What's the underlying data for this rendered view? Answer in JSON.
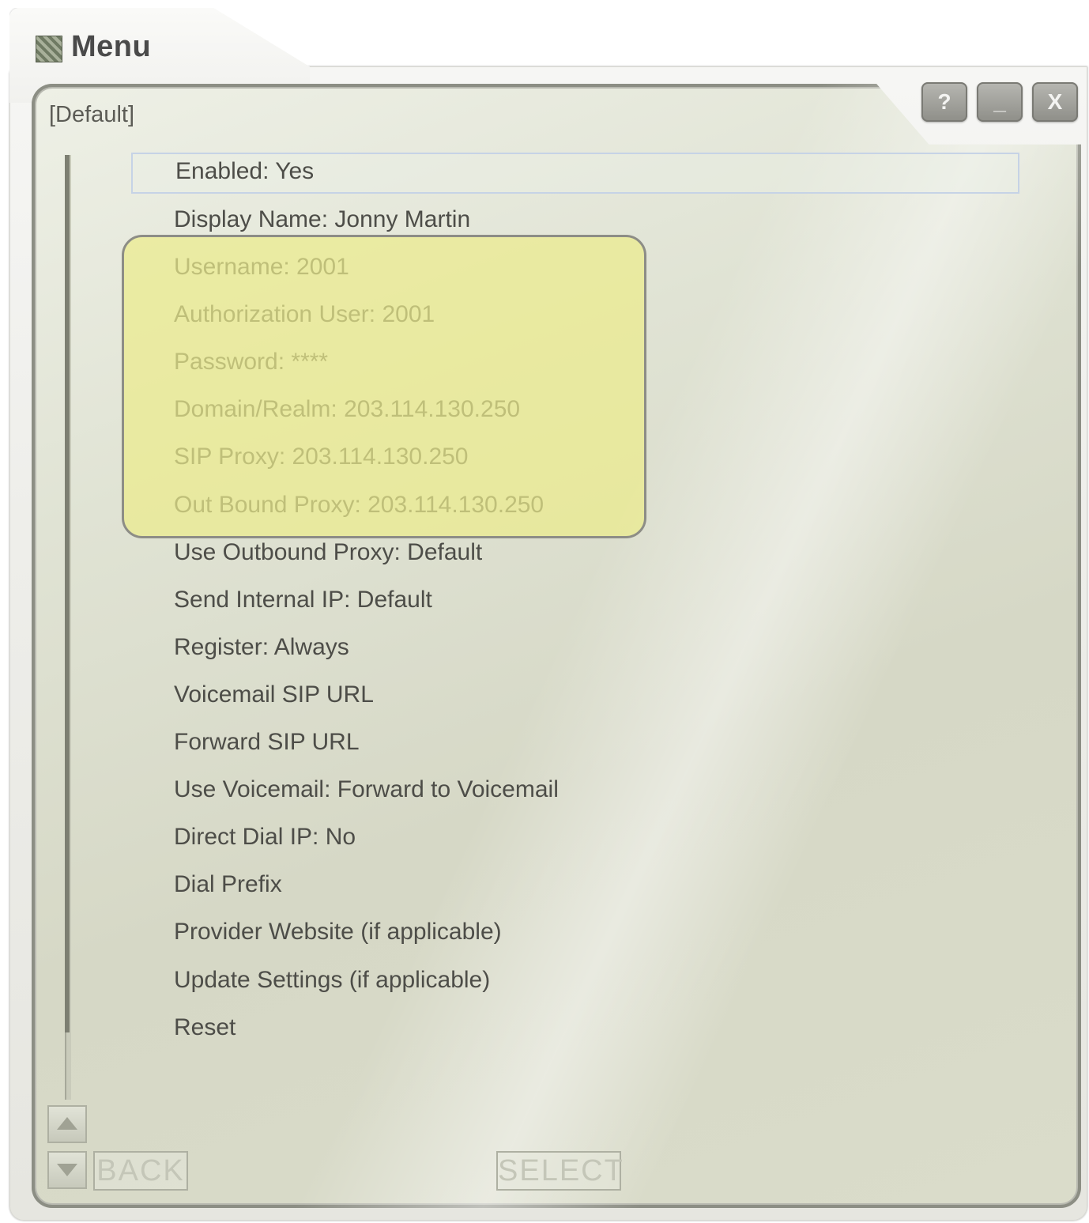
{
  "window": {
    "title": "Menu",
    "icon": "app-icon",
    "controls": {
      "help_label": "?",
      "minimize_label": "_",
      "close_label": "X"
    }
  },
  "profile": {
    "label": "[Default]"
  },
  "menu": {
    "selected_index": 0,
    "items": [
      "Enabled: Yes",
      "Display Name: Jonny Martin",
      "Username: 2001",
      "Authorization User: 2001",
      "Password: ****",
      "Domain/Realm: 203.114.130.250",
      "SIP Proxy: 203.114.130.250",
      "Out Bound Proxy: 203.114.130.250",
      "Use Outbound Proxy: Default",
      "Send Internal IP: Default",
      "Register: Always",
      "Voicemail SIP URL",
      "Forward SIP URL",
      "Use Voicemail: Forward to Voicemail",
      "Direct Dial IP: No",
      "Dial Prefix",
      "Provider Website (if applicable)",
      "Update Settings (if applicable)",
      "Reset"
    ]
  },
  "highlight": {
    "color": "#ECEC8C",
    "covers_items": [
      "Username: 2001",
      "Authorization User: 2001",
      "Password: ****",
      "Domain/Realm: 203.114.130.250",
      "SIP Proxy: 203.114.130.250",
      "Out Bound Proxy: 203.114.130.250"
    ]
  },
  "footer": {
    "back_label": "BACK",
    "select_label": "SELECT"
  },
  "scroll": {
    "up_icon": "scroll-up-arrow-icon",
    "down_icon": "scroll-down-arrow-icon"
  }
}
